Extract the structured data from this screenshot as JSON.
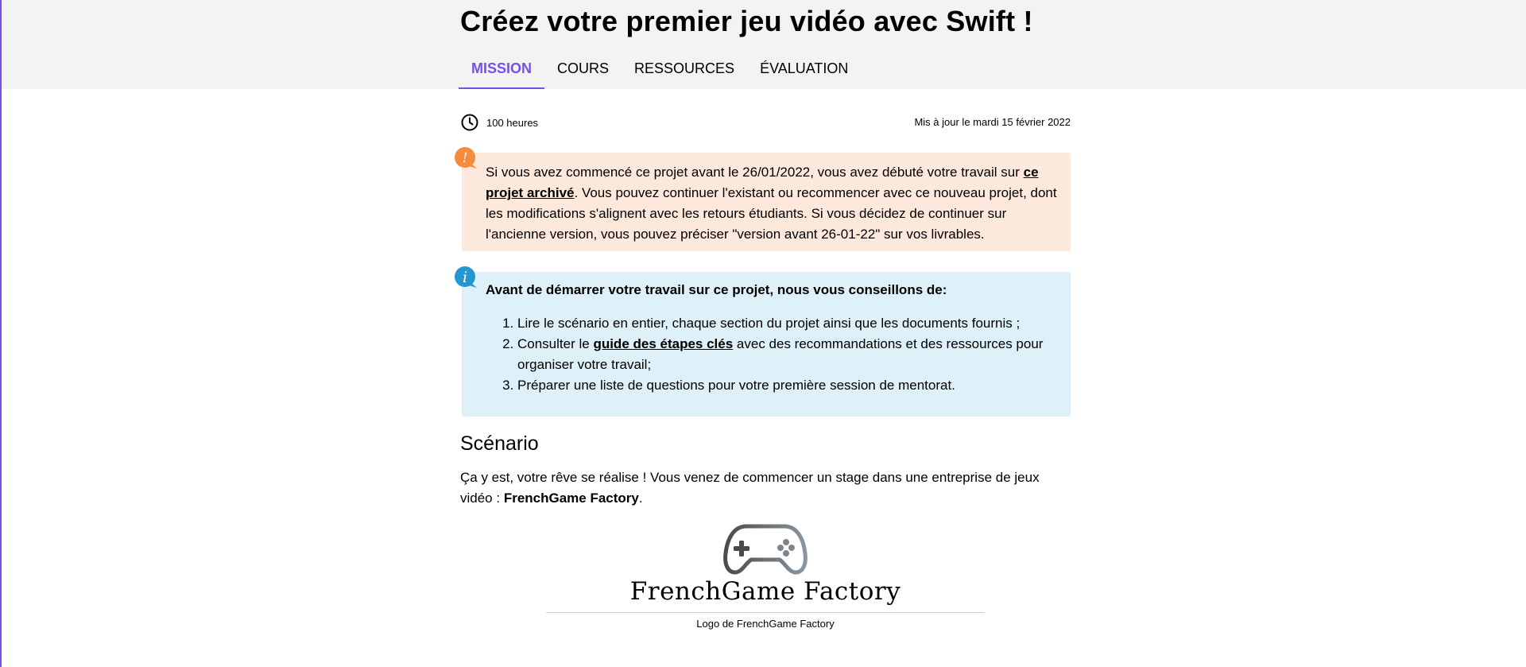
{
  "header": {
    "title": "Créez votre premier jeu vidéo avec Swift !",
    "tabs": [
      {
        "label": "MISSION",
        "active": true
      },
      {
        "label": "COURS",
        "active": false
      },
      {
        "label": "RESSOURCES",
        "active": false
      },
      {
        "label": "ÉVALUATION",
        "active": false
      }
    ]
  },
  "meta": {
    "duration": "100 heures",
    "duration_icon": "clock-icon",
    "updated": "Mis à jour le mardi 15 février 2022"
  },
  "warning": {
    "icon": "exclamation-icon",
    "color": "#f58b3c",
    "text_before": "Si vous avez commencé ce projet avant le 26/01/2022, vous avez débuté votre travail sur ",
    "link": "ce projet archivé",
    "text_after": ". Vous pouvez continuer l'existant ou recommencer avec ce nouveau projet, dont les modifications s'alignent avec les retours étudiants. Si vous décidez de continuer sur l'ancienne version, vous pouvez préciser \"version avant 26-01-22\" sur vos livrables."
  },
  "info": {
    "icon": "info-icon",
    "color": "#2597cf",
    "title": "Avant de démarrer votre travail sur ce projet, nous vous conseillons de:",
    "item1": "Lire le scénario en entier, chaque section du projet ainsi que les documents fournis ;",
    "item2_before": "Consulter le ",
    "item2_link": "guide des étapes clés",
    "item2_after": " avec des recommandations et des ressources pour organiser votre travail;",
    "item3": "Préparer une liste de questions pour votre première session de mentorat."
  },
  "scenario": {
    "title": "Scénario",
    "text_before": "Ça y est, votre rêve se réalise ! Vous venez de commencer un stage dans une entreprise de jeux vidéo : ",
    "company": "FrenchGame Factory",
    "text_after": "."
  },
  "logo": {
    "name": "FrenchGame Factory",
    "icon": "gamepad-icon",
    "caption": "Logo de FrenchGame Factory"
  },
  "colors": {
    "accent": "#7451eb",
    "warning_bg": "#fde9dc",
    "info_bg": "#def1f8",
    "header_bg": "#f3f3f3"
  }
}
